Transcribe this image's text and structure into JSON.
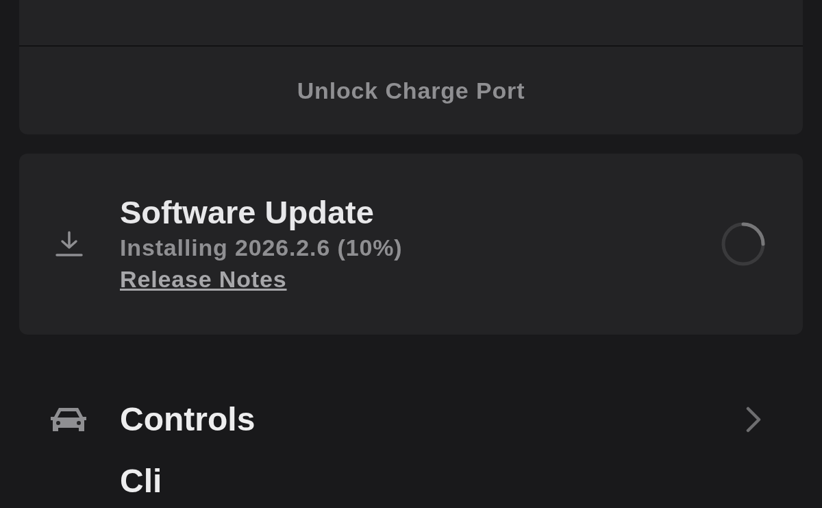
{
  "charge_card": {
    "action": "Unlock Charge Port"
  },
  "software_update": {
    "title": "Software Update",
    "status": "Installing 2026.2.6 (10%)",
    "link": "Release Notes"
  },
  "menu_items": [
    {
      "label": "Controls",
      "chevron": true
    },
    {
      "label": "Cli",
      "chevron": false
    }
  ]
}
